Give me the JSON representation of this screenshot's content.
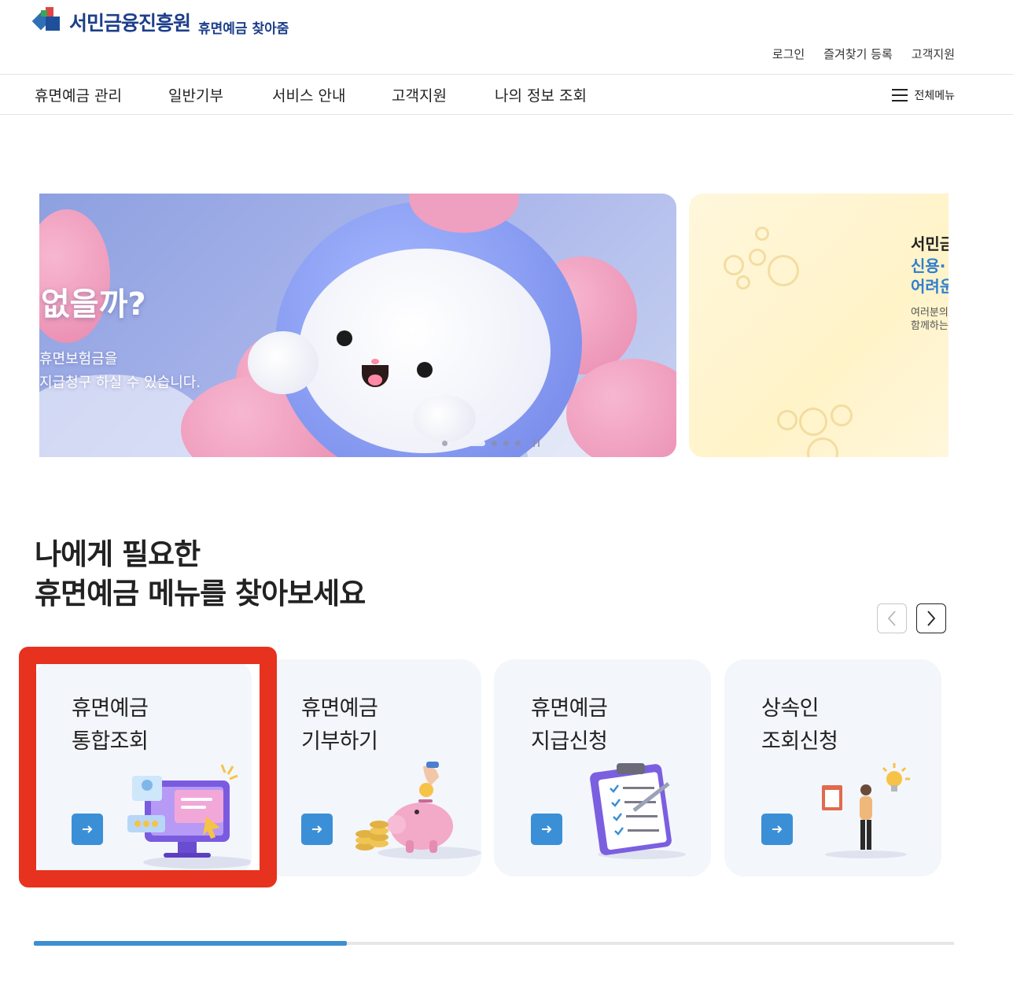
{
  "header": {
    "org_name": "서민금융진흥원",
    "service_name": "휴면예금 찾아줌",
    "util_links": [
      "로그인",
      "즐겨찾기 등록",
      "고객지원"
    ]
  },
  "gnb": {
    "items": [
      "휴면예금 관리",
      "일반기부",
      "서비스 안내",
      "고객지원",
      "나의 정보 조회"
    ],
    "all_menu_label": "전체메뉴"
  },
  "hero": {
    "slide1": {
      "headline": "없을까?",
      "desc_line1": "휴면보험금을",
      "desc_line2": "지급청구 하실 수 있습니다.",
      "active_dot": 1,
      "dot_count": 5
    },
    "slide2": {
      "line1": "서민금",
      "line2": "신용·",
      "line3": "어려운",
      "line4": "여러분의",
      "line5": "함께하는"
    }
  },
  "section": {
    "title_line1": "나에게 필요한",
    "title_line2": "휴면예금 메뉴를 찾아보세요"
  },
  "cards": [
    {
      "line1": "휴면예금",
      "line2": "통합조회",
      "icon": "monitor-icon"
    },
    {
      "line1": "휴면예금",
      "line2": "기부하기",
      "icon": "piggy-bank-icon"
    },
    {
      "line1": "휴면예금",
      "line2": "지급신청",
      "icon": "clipboard-icon"
    },
    {
      "line1": "상속인",
      "line2": "조회신청",
      "icon": "person-idea-icon"
    }
  ],
  "carousel_progress": 0.34,
  "colors": {
    "brand": "#1d3f8a",
    "accent": "#3b8fd6",
    "highlight": "#e6321f"
  }
}
